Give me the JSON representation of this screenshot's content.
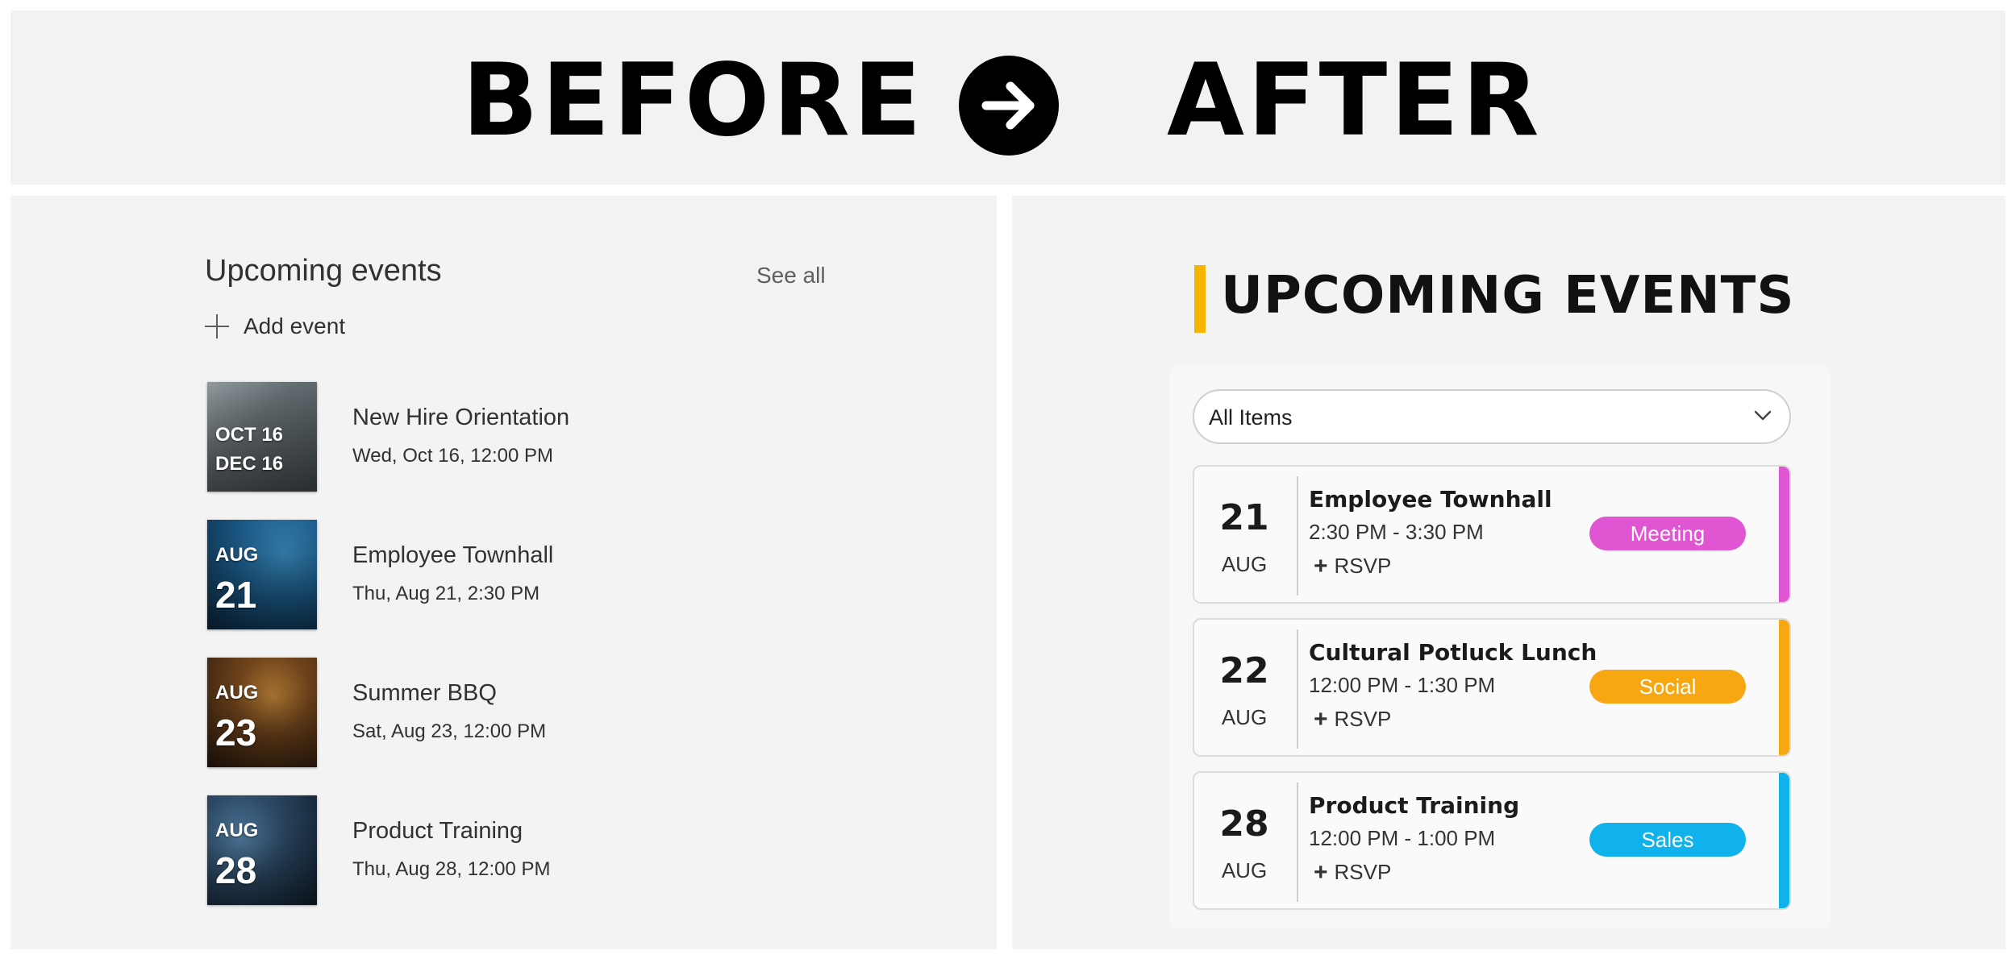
{
  "banner": {
    "before_label": "BEFORE",
    "after_label": "AFTER",
    "arrow_icon": "arrow-right-icon"
  },
  "before": {
    "title": "Upcoming events",
    "see_all": "See all",
    "add_event": "Add event",
    "events": [
      {
        "name": "New Hire Orientation",
        "date": "Wed, Oct 16, 12:00 PM",
        "thumb_line1": "OCT 16",
        "thumb_line2": "DEC 16"
      },
      {
        "name": "Employee Townhall",
        "date": "Thu, Aug 21, 2:30 PM",
        "thumb_month": "AUG",
        "thumb_day": "21"
      },
      {
        "name": "Summer BBQ",
        "date": "Sat, Aug 23, 12:00 PM",
        "thumb_month": "AUG",
        "thumb_day": "23"
      },
      {
        "name": "Product Training",
        "date": "Thu, Aug 28, 12:00 PM",
        "thumb_month": "AUG",
        "thumb_day": "28"
      }
    ]
  },
  "after": {
    "title": "UPCOMING EVENTS",
    "accent_color": "#f5b400",
    "filter": {
      "selected": "All Items"
    },
    "events": [
      {
        "day": "21",
        "month": "AUG",
        "name": "Employee Townhall",
        "time": "2:30 PM - 3:30 PM",
        "rsvp": "RSVP",
        "tag": "Meeting",
        "color": "#e055d2"
      },
      {
        "day": "22",
        "month": "AUG",
        "name": "Cultural Potluck Lunch",
        "time": "12:00 PM - 1:30 PM",
        "rsvp": "RSVP",
        "tag": "Social",
        "color": "#f7a712"
      },
      {
        "day": "28",
        "month": "AUG",
        "name": "Product Training",
        "time": "12:00 PM - 1:00 PM",
        "rsvp": "RSVP",
        "tag": "Sales",
        "color": "#0fb2ea"
      }
    ]
  }
}
